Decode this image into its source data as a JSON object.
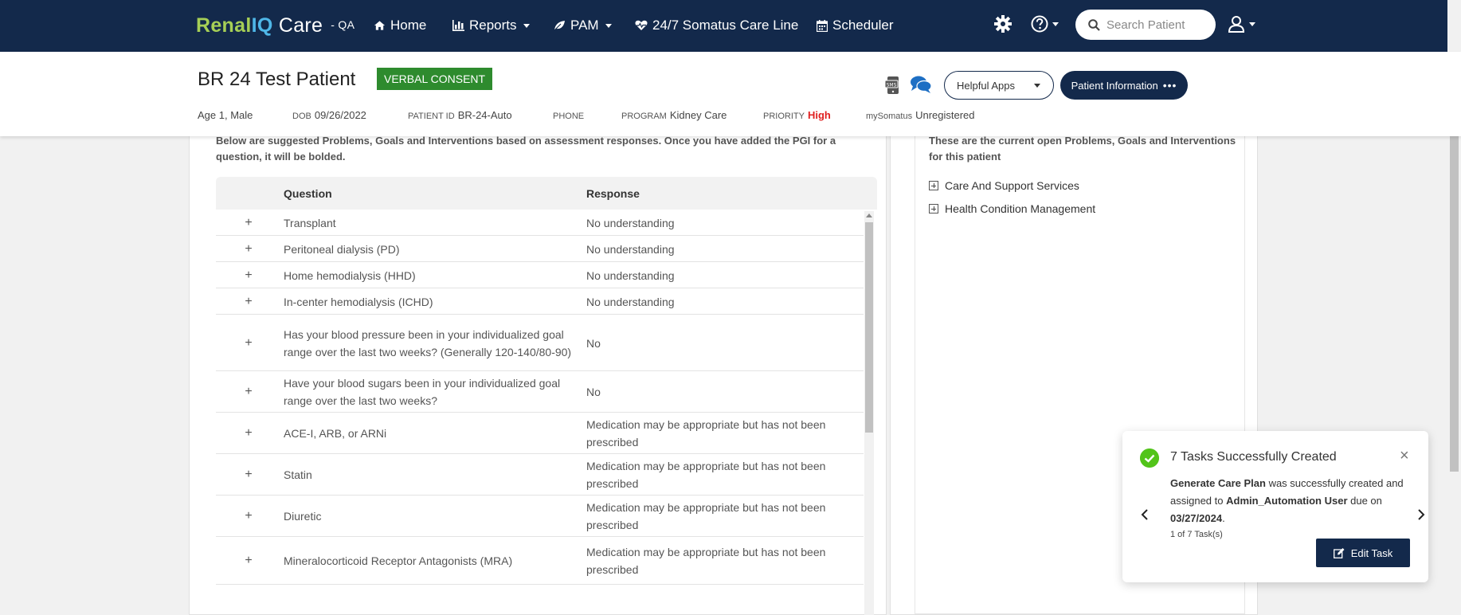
{
  "brand": {
    "renal": "Renal",
    "iq": "IQ",
    "care": " Care",
    "env": "- QA"
  },
  "nav": {
    "home": "Home",
    "reports": "Reports",
    "pam": "PAM",
    "careline": "24/7 Somatus Care Line",
    "scheduler": "Scheduler"
  },
  "search": {
    "placeholder": "Search Patient"
  },
  "patient": {
    "name": "BR 24 Test Patient",
    "consent": "VERBAL CONSENT",
    "age_sex": "Age 1, Male",
    "dob_label": "DOB",
    "dob": "09/26/2022",
    "pid_label": "PATIENT ID",
    "pid": "BR-24-Auto",
    "phone_label": "PHONE",
    "phone": "",
    "program_label": "PROGRAM",
    "program": "Kidney Care",
    "priority_label": "PRIORITY",
    "priority": "High",
    "mysomatus_label": "mySomatus",
    "mysomatus": "Unregistered",
    "helpful_apps": "Helpful Apps",
    "patient_info": "Patient Information"
  },
  "left": {
    "intro": "Below are suggested Problems, Goals and Interventions based on assessment responses. Once you have added the PGI for a question, it will be bolded.",
    "col_question": "Question",
    "col_response": "Response",
    "rows": [
      {
        "q": "Transplant",
        "r": "No understanding"
      },
      {
        "q": "Peritoneal dialysis (PD)",
        "r": "No understanding"
      },
      {
        "q": "Home hemodialysis (HHD)",
        "r": "No understanding"
      },
      {
        "q": "In-center hemodialysis (ICHD)",
        "r": "No understanding"
      },
      {
        "q": "Has your blood pressure been in your individualized goal range over the last two weeks? (Generally 120-140/80-90)",
        "r": "No"
      },
      {
        "q": "Have your blood sugars been in your individualized goal range over the last two weeks?",
        "r": "No"
      },
      {
        "q": "ACE-I, ARB, or ARNi",
        "r": "Medication may be appropriate but has not been prescribed"
      },
      {
        "q": "Statin",
        "r": "Medication may be appropriate but has not been prescribed"
      },
      {
        "q": "Diuretic",
        "r": "Medication may be appropriate but has not been prescribed"
      },
      {
        "q": "Mineralocorticoid Receptor Antagonists (MRA)",
        "r": "Medication may be appropriate but has not been prescribed"
      }
    ]
  },
  "right": {
    "intro": "These are the current open Problems, Goals and Interventions for this patient",
    "items": [
      "Care And Support Services",
      "Health Condition Management"
    ]
  },
  "toast": {
    "title": "7 Tasks Successfully Created",
    "task": "Generate Care Plan",
    "msg1": " was successfully created and assigned to ",
    "user": "Admin_Automation User",
    "msg2": " due on ",
    "due": "03/27/2024",
    "msg3": ".",
    "count": "1 of 7 Task(s)",
    "edit": "Edit Task"
  },
  "colors": {
    "nav_bg": "#13294b",
    "consent_green": "#2e8b2e",
    "priority_red": "#e02020",
    "success": "#52c41a"
  },
  "icons": [
    "home-icon",
    "bar-chart-icon",
    "leaf-icon",
    "heartbeat-icon",
    "calendar-icon",
    "gear-icon",
    "help-icon",
    "search-icon",
    "user-icon",
    "sms-icon",
    "chat-icon",
    "check-circle-icon",
    "close-icon",
    "edit-icon"
  ]
}
